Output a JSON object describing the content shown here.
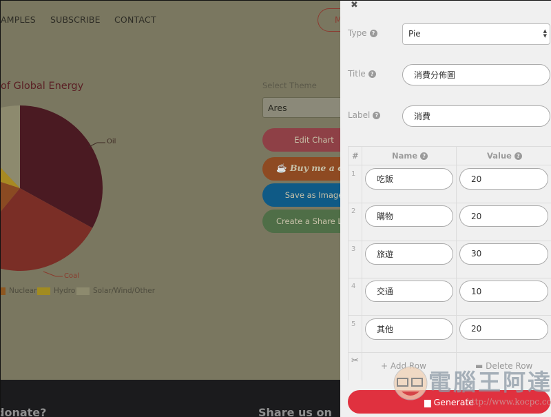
{
  "nav": {
    "items": [
      "AMPLES",
      "SUBSCRIBE",
      "CONTACT"
    ],
    "cta_label": "M"
  },
  "chart_data": {
    "type": "pie",
    "title": "of Global Energy",
    "categories": [
      "Oil",
      "Coal",
      "Nuclear",
      "Hydro",
      "Solar/Wind/Other"
    ],
    "values": [
      33,
      28,
      19,
      8,
      12
    ],
    "colors": [
      "#4a1a22",
      "#7a2e26",
      "#8a4a22",
      "#a88a22",
      "#8d8a6e"
    ],
    "slice_labels": [
      "Oil",
      "Coal"
    ],
    "legend": [
      "Nuclear",
      "Hydro",
      "Solar/Wind/Other"
    ],
    "legend_colors": [
      "#8e5720",
      "#a18b20",
      "#8d8a6e"
    ],
    "legend_position": "bottom"
  },
  "theme": {
    "label": "Select Theme",
    "value": "Ares"
  },
  "side_buttons": [
    {
      "label": "Edit Chart",
      "color": "#8e4046"
    },
    {
      "label": "Buy me a coffee",
      "color": "#8e4a22"
    },
    {
      "label": "Save as Image",
      "color": "#0f5a86"
    },
    {
      "label": "Create a Share Link",
      "color": "#4f6e47"
    }
  ],
  "footer": {
    "left": "donate?",
    "right": "Share us on"
  },
  "panel": {
    "close_icon": "✖",
    "type": {
      "label": "Type",
      "value": "Pie"
    },
    "title": {
      "label": "Title",
      "value": "消費分佈圖"
    },
    "label": {
      "label": "Label",
      "value": "消費"
    },
    "table": {
      "headers": [
        "#",
        "Name",
        "Value"
      ],
      "rows": [
        {
          "num": "1",
          "name": "吃飯",
          "value": "20"
        },
        {
          "num": "2",
          "name": "購物",
          "value": "20"
        },
        {
          "num": "3",
          "name": "旅遊",
          "value": "30"
        },
        {
          "num": "4",
          "name": "交通",
          "value": "10"
        },
        {
          "num": "5",
          "name": "其他",
          "value": "20"
        }
      ],
      "add_row": "Add Row",
      "delete_row": "Delete Row"
    },
    "generate": "Generate"
  },
  "watermark": {
    "text": "電腦王阿達",
    "url": "http://www.kocpc.com.tw"
  }
}
